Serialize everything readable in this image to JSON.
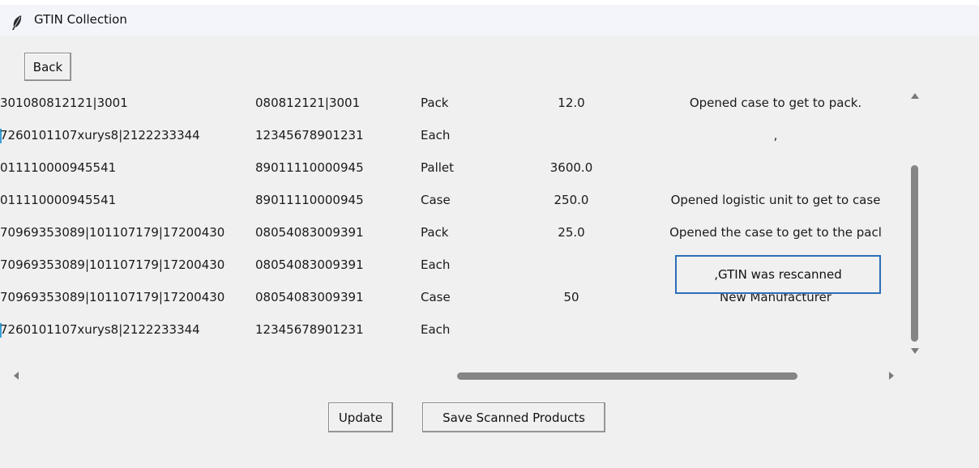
{
  "window": {
    "title": "GTIN Collection",
    "icon": "feather-icon"
  },
  "buttons": {
    "back": "Back",
    "update": "Update",
    "save": "Save Scanned Products"
  },
  "table": {
    "rows": [
      {
        "c1": "301080812121|3001",
        "c2": "080812121|3001",
        "c3": "Pack",
        "c4": "12.0",
        "c5": "Opened case to get to pack.",
        "marker": false
      },
      {
        "c1": "7260101107xurys8|2122233344",
        "c2": "12345678901231",
        "c3": "Each",
        "c4": "",
        "c5": ",",
        "marker": true
      },
      {
        "c1": "011110000945541",
        "c2": "89011110000945",
        "c3": "Pallet",
        "c4": "3600.0",
        "c5": "",
        "marker": false
      },
      {
        "c1": "011110000945541",
        "c2": "89011110000945",
        "c3": "Case",
        "c4": "250.0",
        "c5": "Opened logistic unit to get to case",
        "marker": false
      },
      {
        "c1": "70969353089|101107179|17200430",
        "c2": "08054083009391",
        "c3": "Pack",
        "c4": "25.0",
        "c5": "Opened the case to get to the pacl",
        "marker": false
      },
      {
        "c1": "70969353089|101107179|17200430",
        "c2": "08054083009391",
        "c3": "Each",
        "c4": "",
        "c5": "",
        "marker": false
      },
      {
        "c1": "70969353089|101107179|17200430",
        "c2": "08054083009391",
        "c3": "Case",
        "c4": "50",
        "c5": "New Manufacturer",
        "marker": false
      },
      {
        "c1": "7260101107xurys8|2122233344",
        "c2": "12345678901231",
        "c3": "Each",
        "c4": "",
        "c5": "",
        "marker": true
      }
    ],
    "edit_value": ",GTIN was rescanned"
  },
  "colors": {
    "focus_border": "#2a6fb8",
    "row_marker": "#3aa0d8",
    "scrollbar_thumb": "#858585"
  }
}
